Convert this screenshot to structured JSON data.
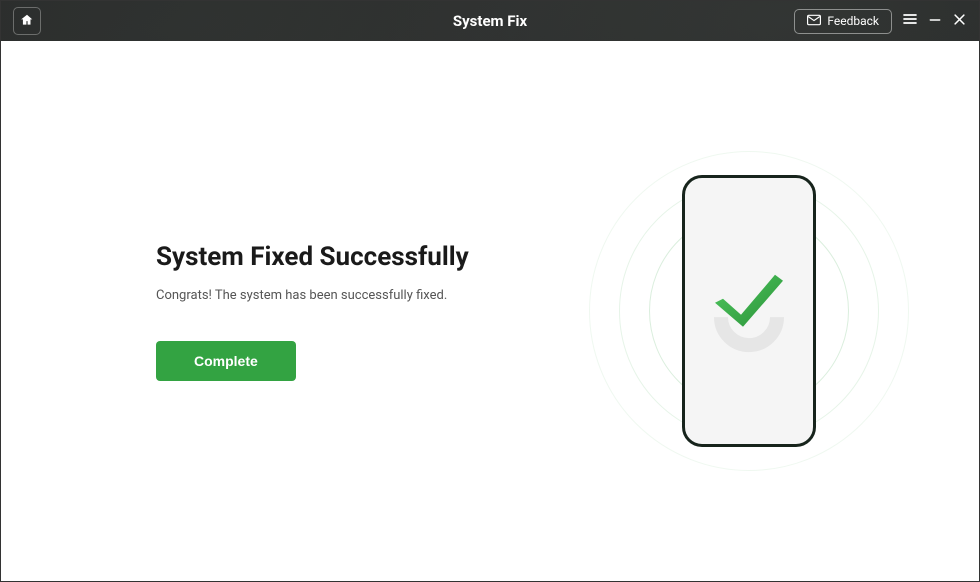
{
  "titlebar": {
    "title": "System Fix",
    "feedback_label": "Feedback"
  },
  "main": {
    "heading": "System Fixed Successfully",
    "subtitle": "Congrats! The system has been successfully fixed.",
    "complete_button": "Complete"
  },
  "colors": {
    "accent": "#33a342",
    "titlebar_bg": "#2b2d2c"
  }
}
